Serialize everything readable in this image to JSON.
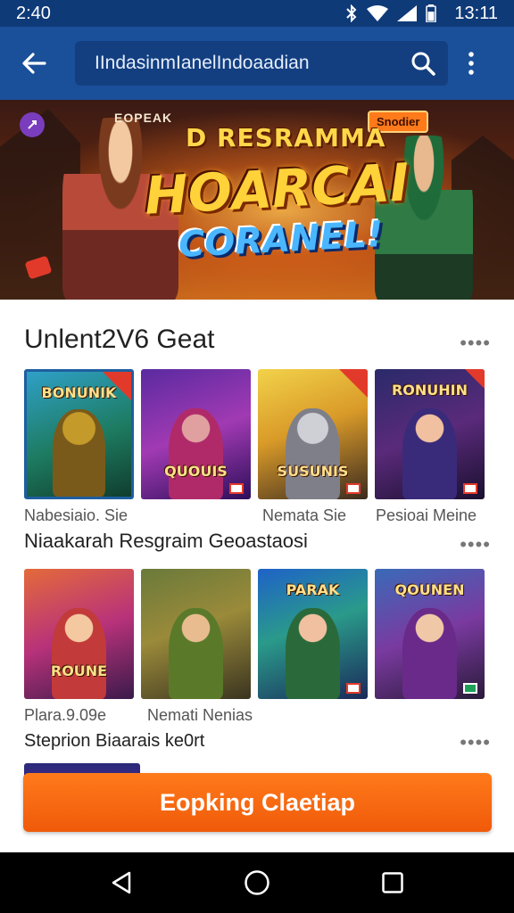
{
  "status_bar": {
    "time_left": "2:40",
    "time_right": "13:11",
    "icons": [
      "bluetooth-icon",
      "wifi-icon",
      "signal-icon",
      "battery-icon"
    ]
  },
  "app_bar": {
    "search_value": "IIndasinmIanelIndoaadian",
    "icons": [
      "back-arrow-icon",
      "search-icon",
      "more-vertical-icon"
    ]
  },
  "hero": {
    "brand": "EOPEAK",
    "tag": "Snodier",
    "title_line1": "D RESRAMMA",
    "title_line2": "HOARCAI",
    "title_line3": "CORANEL!"
  },
  "sections": [
    {
      "title": "Unlent2V6 Geat",
      "more": "••••",
      "cards": [
        {
          "label": "BONUNIK"
        },
        {
          "label": "QUOUIS"
        },
        {
          "label": "SUSUNIS"
        },
        {
          "label": "RONUHIN"
        }
      ],
      "captions": [
        "Nabesiaio. Sie",
        "Nemata Sie",
        "Pesioai Meine"
      ]
    },
    {
      "title": "Niaakarah Resgraim Geoastaosi",
      "more": "••••",
      "cards": [
        {
          "label": "ROUNE"
        },
        {
          "label": ""
        },
        {
          "label": "PARAK"
        },
        {
          "label": "QOUNEN"
        }
      ],
      "captions": [
        "Plara.9.09e",
        "Nemati Nenias"
      ]
    },
    {
      "title": "Steprion Biaarais ke0rt",
      "more": "••••"
    }
  ],
  "cta": {
    "label": "Eopking Claetiap"
  },
  "colors": {
    "status_bar": "#0f3a78",
    "app_bar": "#1a4f9a",
    "cta": "#f26a12"
  }
}
